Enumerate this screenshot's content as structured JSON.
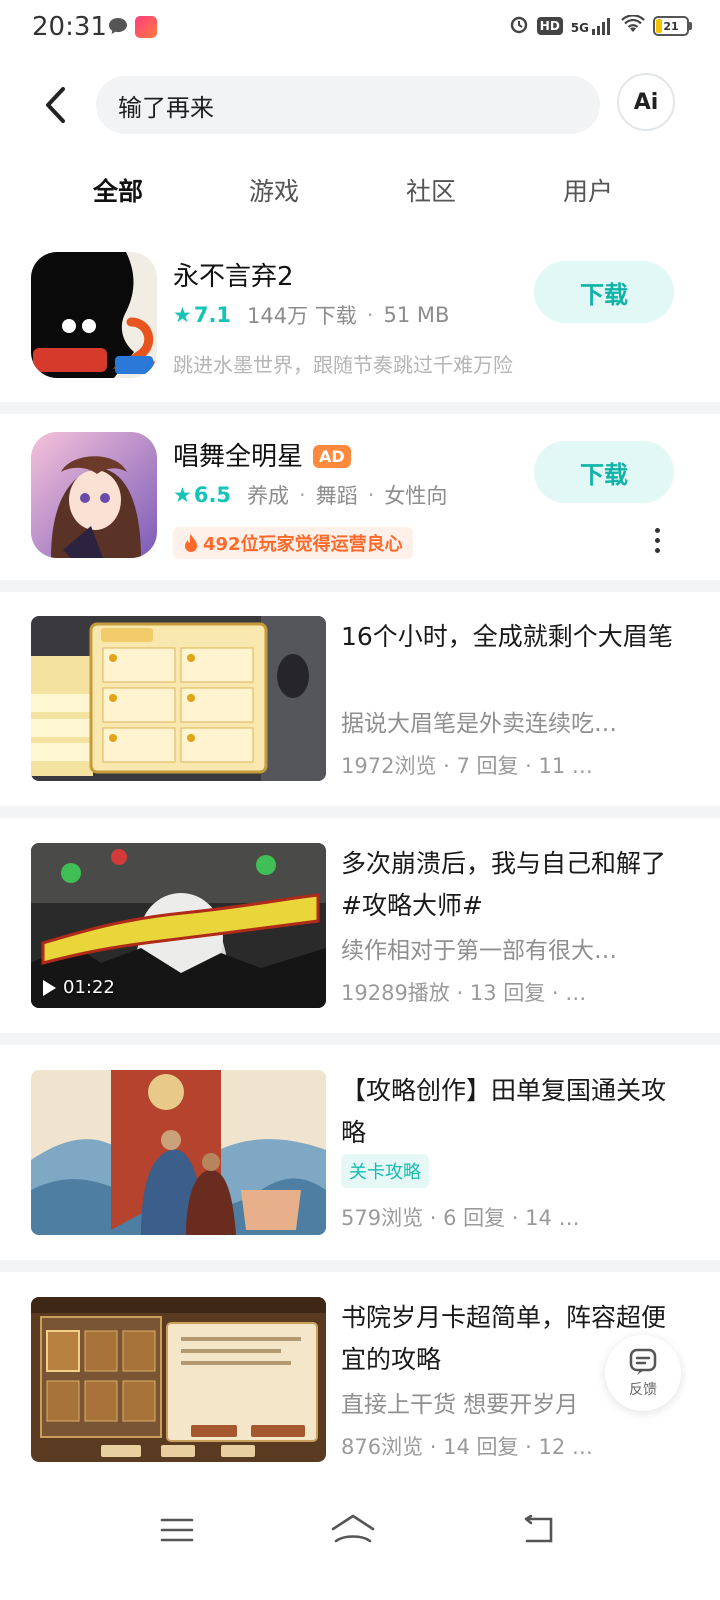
{
  "status_bar": {
    "time": "20:31",
    "hd_label": "HD",
    "network_label": "5G",
    "battery_level": 21,
    "battery_text": "21"
  },
  "search": {
    "query": "输了再来",
    "ai_label": "Ai"
  },
  "tabs": [
    {
      "label": "全部",
      "active": true
    },
    {
      "label": "游戏",
      "active": false
    },
    {
      "label": "社区",
      "active": false
    },
    {
      "label": "用户",
      "active": false
    }
  ],
  "colors": {
    "accent": "#17d3c5",
    "download_bg": "#e2f8f5",
    "download_text": "#0fb3a7",
    "ad_badge": "#ff8a3d"
  },
  "apps": [
    {
      "name": "永不言弃2",
      "rating": "7.1",
      "downloads": "144万 下载",
      "size": "51 MB",
      "description": "跳进水墨世界，跟随节奏跳过千难万险",
      "button_label": "下载"
    },
    {
      "name": "唱舞全明星",
      "ad_label": "AD",
      "rating": "6.5",
      "tags": [
        "养成",
        "舞蹈",
        "女性向"
      ],
      "hot_text": "492位玩家觉得运营良心",
      "button_label": "下载"
    }
  ],
  "posts": [
    {
      "title": "16个小时，全成就剩个大眉笔",
      "description": "据说大眉笔是外卖连续吃…",
      "stats": "1972浏览 · 7 回复 · 11 …"
    },
    {
      "title": "多次崩溃后，我与自己和解了#攻略大师#",
      "description": "续作相对于第一部有很大…",
      "stats": "19289播放 · 13 回复 · …",
      "video_duration": "01:22"
    },
    {
      "title": "【攻略创作】田单复国通关攻略",
      "tag": "关卡攻略",
      "stats": "579浏览 · 6 回复 · 14 …"
    },
    {
      "title": "书院岁月卡超简单，阵容超便宜的攻略",
      "description": "直接上干货 想要开岁月",
      "stats": "876浏览 · 14 回复 · 12 …"
    }
  ],
  "feedback": {
    "label": "反馈"
  }
}
